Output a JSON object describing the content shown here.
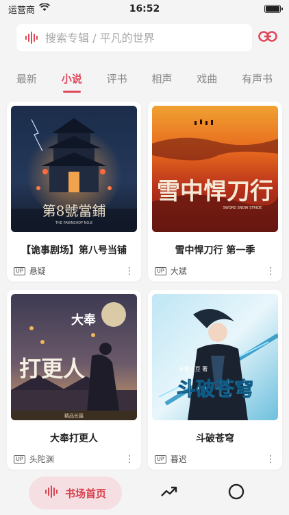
{
  "status_bar": {
    "carrier": "运营商",
    "time": "16:52"
  },
  "search": {
    "placeholder": "搜索专辑 / 平凡的世界"
  },
  "tabs": [
    {
      "label": "最新",
      "active": false
    },
    {
      "label": "小说",
      "active": true
    },
    {
      "label": "评书",
      "active": false
    },
    {
      "label": "相声",
      "active": false
    },
    {
      "label": "戏曲",
      "active": false
    },
    {
      "label": "有声书",
      "active": false
    }
  ],
  "cards": [
    {
      "title": "【诡事剧场】第八号当铺",
      "author": "悬疑",
      "badge": "UP",
      "cover_text": "第8號當鋪",
      "cover_sub": "THE PAWNSHOP NO.8"
    },
    {
      "title": "雪中悍刀行 第一季",
      "author": "大斌",
      "badge": "UP",
      "cover_text": "雪中悍刀行",
      "cover_sub": "SWORD SNOW STRIDE"
    },
    {
      "title": "大奉打更人",
      "author": "头陀渊",
      "badge": "UP",
      "cover_text": "打更人",
      "cover_top": "大奉",
      "cover_sub": "精品长篇"
    },
    {
      "title": "斗破苍穹",
      "author": "暮迟",
      "badge": "UP",
      "cover_text": "斗破苍穹",
      "cover_top": "天蚕土豆 著"
    }
  ],
  "bottom_nav": {
    "home_label": "书场首页"
  },
  "colors": {
    "accent": "#e0485a",
    "accent_bg": "#f6dfe2"
  },
  "icons": {
    "more": "more-vertical-icon",
    "link": "link-icon",
    "wave": "sound-wave-icon",
    "trend": "trending-up-icon",
    "circle": "circle-icon"
  }
}
